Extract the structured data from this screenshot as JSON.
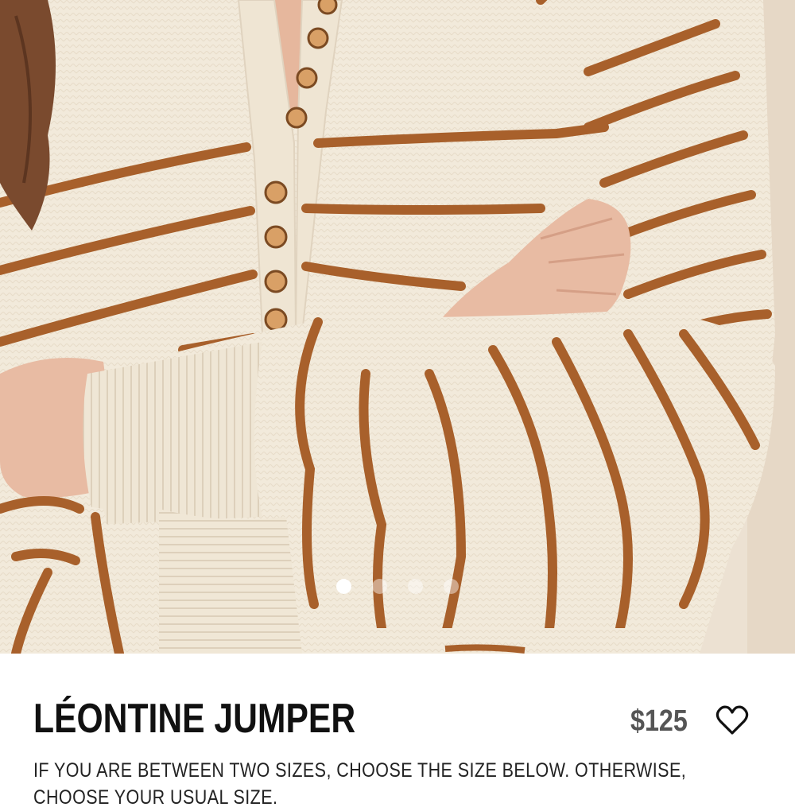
{
  "product": {
    "title": "LÉONTINE JUMPER",
    "price": "$125",
    "size_note": "IF YOU ARE BETWEEN TWO SIZES, CHOOSE THE SIZE BELOW. OTHERWISE, CHOOSE YOUR USUAL SIZE."
  },
  "gallery": {
    "image_count": 4,
    "active_index": 0
  },
  "icons": {
    "wishlist": "heart-outline-icon"
  },
  "colors": {
    "sweater": "#f2eadb",
    "stripe": "#a8602b",
    "background": "#ece1d2",
    "skin": "#e8bba3",
    "hair": "#7a4a2e",
    "title_text": "#111111",
    "price_text": "#555555"
  }
}
